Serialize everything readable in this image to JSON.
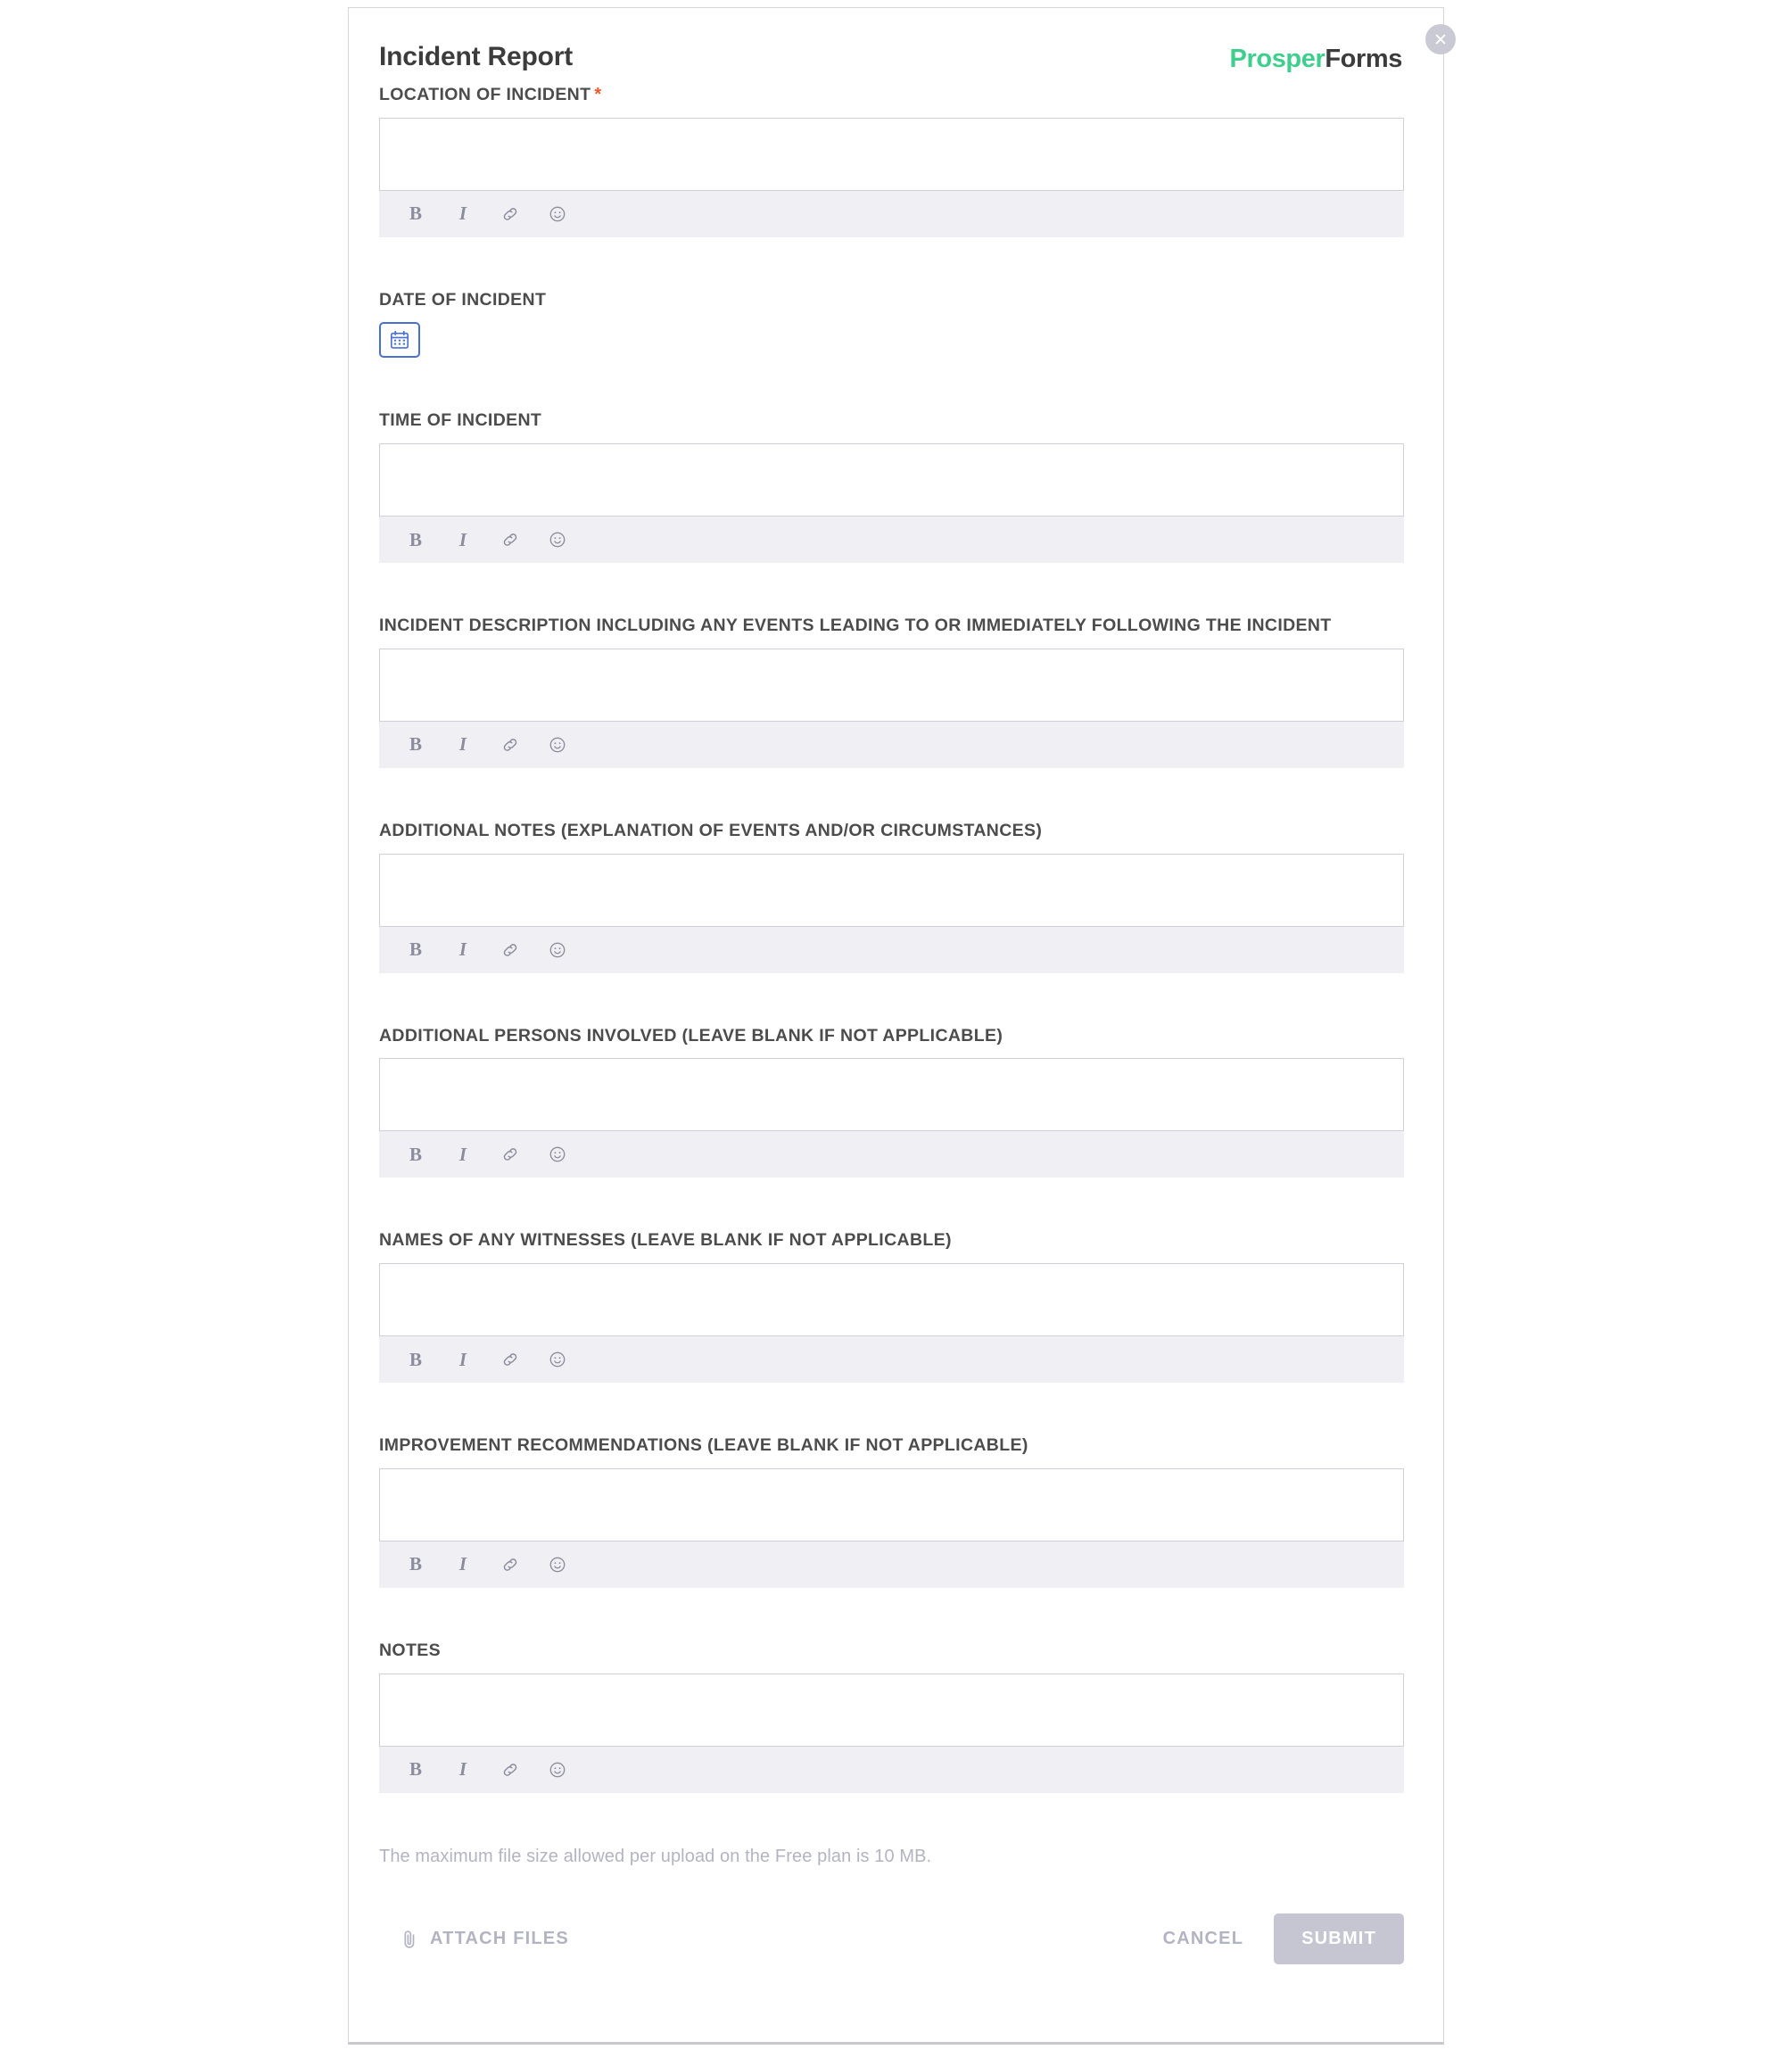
{
  "card": {
    "title": "Incident Report",
    "brand": {
      "part1": "Prosper",
      "part2": "Forms"
    },
    "close_icon": "close-icon"
  },
  "toolbar_icons": {
    "bold": "B",
    "italic": "I",
    "link": "link-icon",
    "emoji": "emoji-icon"
  },
  "colors": {
    "brand_green": "#3ecf8e",
    "brand_dark": "#3c3c3c",
    "required_star": "#f0572a",
    "label": "#4c4c4c",
    "toolbar_bg": "#f0f0f4",
    "input_border": "#cfd0da",
    "date_button_border": "#4a6fd4",
    "muted_text": "#b3b4c2",
    "submit_bg": "#c5c6d2",
    "card_border": "#d6d6d6"
  },
  "fields": [
    {
      "id": "location-of-incident",
      "label": "LOCATION OF INCIDENT",
      "required": true,
      "star": "*",
      "type": "richtext",
      "value": ""
    },
    {
      "id": "date-of-incident",
      "label": "DATE OF INCIDENT",
      "required": false,
      "star": "",
      "type": "date",
      "value": "",
      "icon": "calendar-icon"
    },
    {
      "id": "time-of-incident",
      "label": "TIME OF INCIDENT",
      "required": false,
      "star": "",
      "type": "richtext",
      "value": ""
    },
    {
      "id": "incident-description",
      "label": "INCIDENT DESCRIPTION INCLUDING ANY EVENTS LEADING TO OR IMMEDIATELY FOLLOWING THE INCIDENT",
      "required": false,
      "star": "",
      "type": "richtext",
      "value": ""
    },
    {
      "id": "additional-notes",
      "label": "ADDITIONAL NOTES (EXPLANATION OF EVENTS AND/OR CIRCUMSTANCES)",
      "required": false,
      "star": "",
      "type": "richtext",
      "value": ""
    },
    {
      "id": "additional-persons-involved",
      "label": "ADDITIONAL PERSONS INVOLVED (LEAVE BLANK IF NOT APPLICABLE)",
      "required": false,
      "star": "",
      "type": "richtext",
      "value": ""
    },
    {
      "id": "names-of-any-witnesses",
      "label": "NAMES OF ANY WITNESSES (LEAVE BLANK IF NOT APPLICABLE)",
      "required": false,
      "star": "",
      "type": "richtext",
      "value": ""
    },
    {
      "id": "improvement-recommendations",
      "label": "IMPROVEMENT RECOMMENDATIONS (LEAVE BLANK IF NOT APPLICABLE)",
      "required": false,
      "star": "",
      "type": "richtext",
      "value": ""
    },
    {
      "id": "notes",
      "label": "NOTES",
      "required": false,
      "star": "",
      "type": "richtext",
      "value": ""
    }
  ],
  "footer": {
    "file_note": "The maximum file size allowed per upload on the Free plan is 10 MB.",
    "attach_label": "ATTACH FILES",
    "attach_icon": "paperclip-icon",
    "cancel_label": "CANCEL",
    "submit_label": "SUBMIT",
    "submit_disabled": true
  }
}
